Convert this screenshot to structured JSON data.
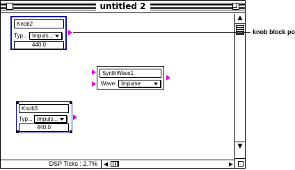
{
  "window": {
    "title": "untitled 2"
  },
  "status": {
    "dsp_ticks": "DSP Ticks : 2.7%"
  },
  "knob2": {
    "name": "Knob2",
    "type_label": "Typ...",
    "type_value": "Impuls...",
    "value": "440.0"
  },
  "synthwave": {
    "name": "SynthWave1",
    "wave_label": "Wave:",
    "wave_value": "Impulse"
  },
  "knob3": {
    "name": "Knob3",
    "type_label": "Typ...",
    "type_value": "Impuls...",
    "value": "440.0"
  },
  "callout": {
    "text": "knob block port"
  },
  "colors": {
    "port": "#e000e0",
    "selection": "#10109a"
  }
}
